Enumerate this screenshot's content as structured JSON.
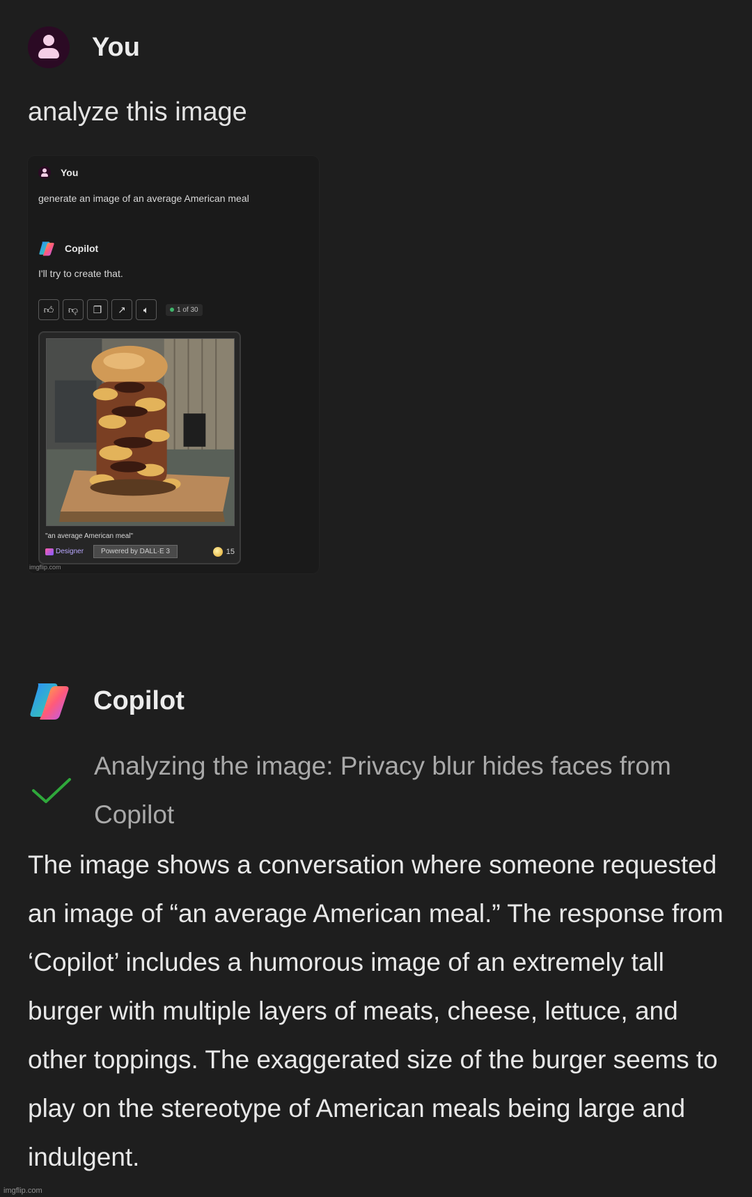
{
  "user_message": {
    "sender": "You",
    "text": "analyze this image"
  },
  "attachment": {
    "user_name": "You",
    "user_prompt": "generate an image of an average American meal",
    "assistant_name": "Copilot",
    "assistant_reply": "I'll try to create that.",
    "counter": "1 of 30",
    "image_caption": "\"an average American meal\"",
    "designer_label": "Designer",
    "powered_by": "Powered by DALL·E 3",
    "boost_count": "15",
    "watermark": "imgflip.com"
  },
  "copilot_message": {
    "sender": "Copilot",
    "status": "Analyzing the image: Privacy blur hides faces from Copilot",
    "answer": "The image shows a conversation where someone requested an image of “an average American meal.” The response from ‘Copilot’ includes a humorous image of an extremely tall burger with multiple layers of meats, cheese, lettuce, and other toppings. The exaggerated size of the burger seems to play on the stereotype of American meals being large and indulgent."
  },
  "footer": {
    "watermark": "imgflip.com"
  },
  "icons": {
    "user_avatar": "user-avatar-icon",
    "copilot_logo": "copilot-logo-icon",
    "status": "check-icon",
    "actions": [
      "thumbs-up-icon",
      "thumbs-down-icon",
      "copy-icon",
      "share-icon",
      "speaker-icon"
    ]
  },
  "colors": {
    "background": "#1e1e1e",
    "check": "#2fa83b",
    "avatar_bg": "#2b0a24"
  }
}
